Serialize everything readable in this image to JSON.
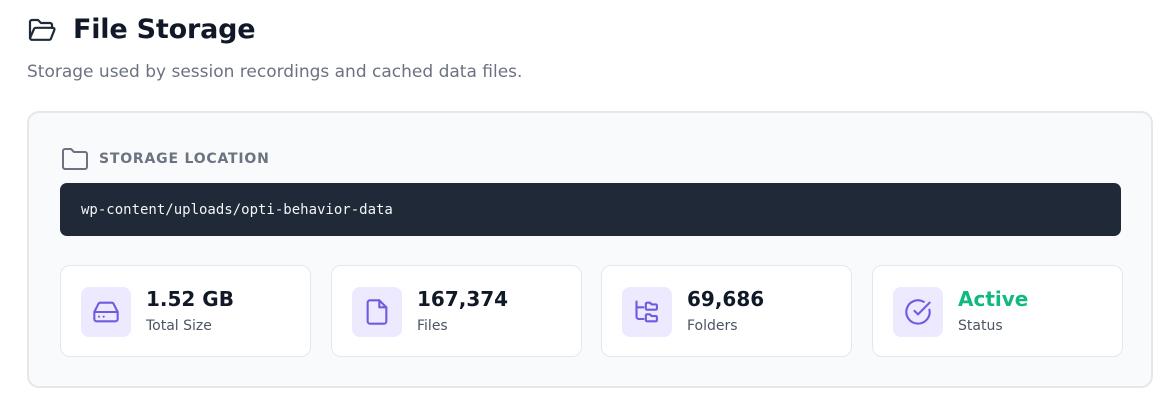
{
  "header": {
    "title": "File Storage",
    "icon": "folder-open-icon",
    "subtitle": "Storage used by session recordings and cached data files."
  },
  "storage_location": {
    "label": "Storage Location",
    "icon": "folder-icon",
    "path": "wp-content/uploads/opti-behavior-data"
  },
  "stats": [
    {
      "value": "1.52 GB",
      "label": "Total Size",
      "icon": "hard-drive-icon"
    },
    {
      "value": "167,374",
      "label": "Files",
      "icon": "file-icon"
    },
    {
      "value": "69,686",
      "label": "Folders",
      "icon": "folder-tree-icon"
    },
    {
      "value": "Active",
      "label": "Status",
      "icon": "check-circle-icon"
    }
  ],
  "colors": {
    "accent": "#6d5ce0",
    "icon_bg": "#ede9fe",
    "status_active": "#10b981",
    "path_bg": "#1f2937"
  }
}
